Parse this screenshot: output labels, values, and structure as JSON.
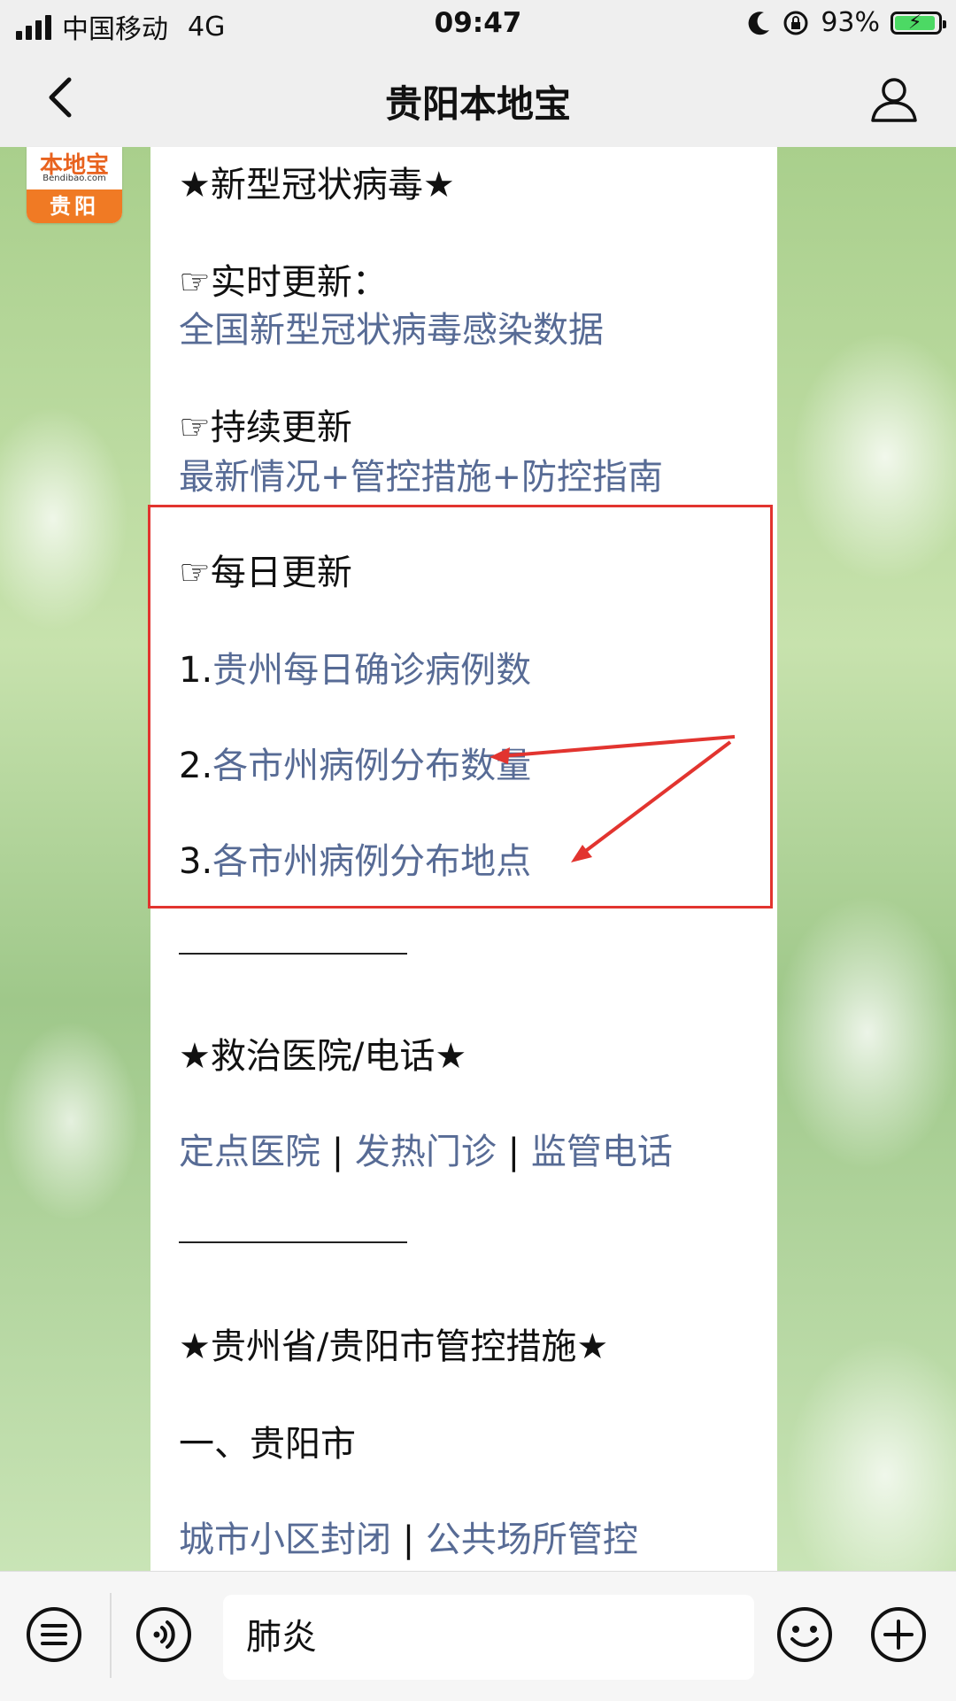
{
  "status_bar": {
    "carrier": "中国移动",
    "network": "4G",
    "time": "09:47",
    "battery_percent": "93%",
    "battery_level": 0.93,
    "icons": [
      "signal-icon",
      "moon-icon",
      "rotation-lock-icon",
      "battery-charging-icon"
    ]
  },
  "nav": {
    "title": "贵阳本地宝",
    "back_icon": "chevron-left-icon",
    "profile_icon": "profile-icon"
  },
  "avatar": {
    "brand": "本地宝",
    "url": "Bendibao.com",
    "city": "贵阳"
  },
  "message": {
    "section1_title": "★新型冠状病毒★",
    "realtime_label": "☞实时更新：",
    "realtime_link": "全国新型冠状病毒感染数据",
    "continuous_label": "☞持续更新",
    "continuous_links": [
      "最新情况",
      "管控措施",
      "防控指南"
    ],
    "plus": "+",
    "daily_label": "☞每日更新",
    "daily_items": [
      {
        "num": "1.",
        "text": "贵州每日确诊病例数"
      },
      {
        "num": "2.",
        "text": "各市州病例分布数量"
      },
      {
        "num": "3.",
        "text": "各市州病例分布地点"
      }
    ],
    "section2_title": "★救治医院/电话★",
    "hospital_links": [
      "定点医院",
      "发热门诊",
      "监管电话"
    ],
    "pipe": "|",
    "section3_title": "★贵州省/贵阳市管控措施★",
    "guiyang_label": "一、贵阳市",
    "guiyang_links": [
      "城市小区封闭",
      "公共场所管控"
    ]
  },
  "input_bar": {
    "text": "肺炎",
    "icons": [
      "menu-list-icon",
      "voice-icon",
      "emoji-icon",
      "plus-icon"
    ]
  },
  "colors": {
    "link": "#576b95",
    "highlight": "#e2342f",
    "accent": "#f07a24"
  }
}
